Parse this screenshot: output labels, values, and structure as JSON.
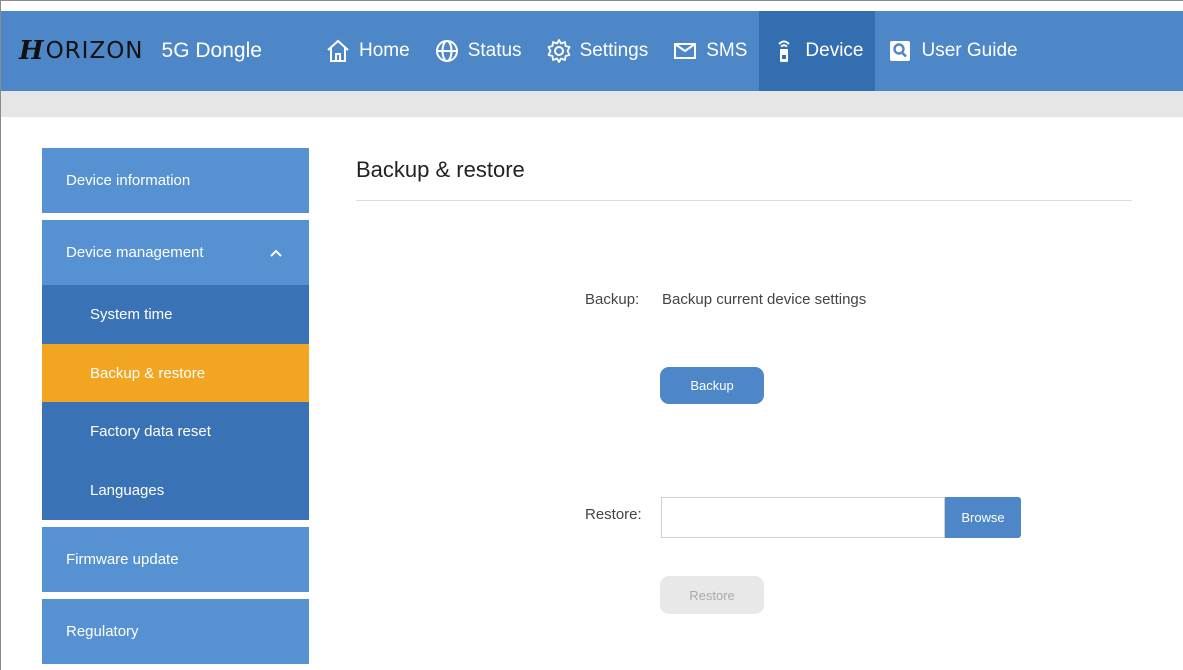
{
  "brand": {
    "mark": "H",
    "name": "ORIZON",
    "product": "5G Dongle"
  },
  "nav": {
    "home": "Home",
    "status": "Status",
    "settings": "Settings",
    "sms": "SMS",
    "device": "Device",
    "user_guide": "User Guide"
  },
  "sidebar": {
    "device_information": "Device information",
    "device_management": "Device management",
    "system_time": "System time",
    "backup_restore": "Backup & restore",
    "factory_reset": "Factory data reset",
    "languages": "Languages",
    "firmware_update": "Firmware update",
    "regulatory": "Regulatory"
  },
  "main": {
    "title": "Backup & restore",
    "backup_label": "Backup:",
    "backup_desc": "Backup current device settings",
    "backup_button": "Backup",
    "restore_label": "Restore:",
    "restore_file_value": "",
    "browse_button": "Browse",
    "restore_button": "Restore"
  },
  "colors": {
    "nav_bg": "#4d87c7",
    "nav_active": "#336fb0",
    "sidebar_top": "#5691d2",
    "sidebar_sub": "#3a72b6",
    "sidebar_active": "#f1a520"
  }
}
